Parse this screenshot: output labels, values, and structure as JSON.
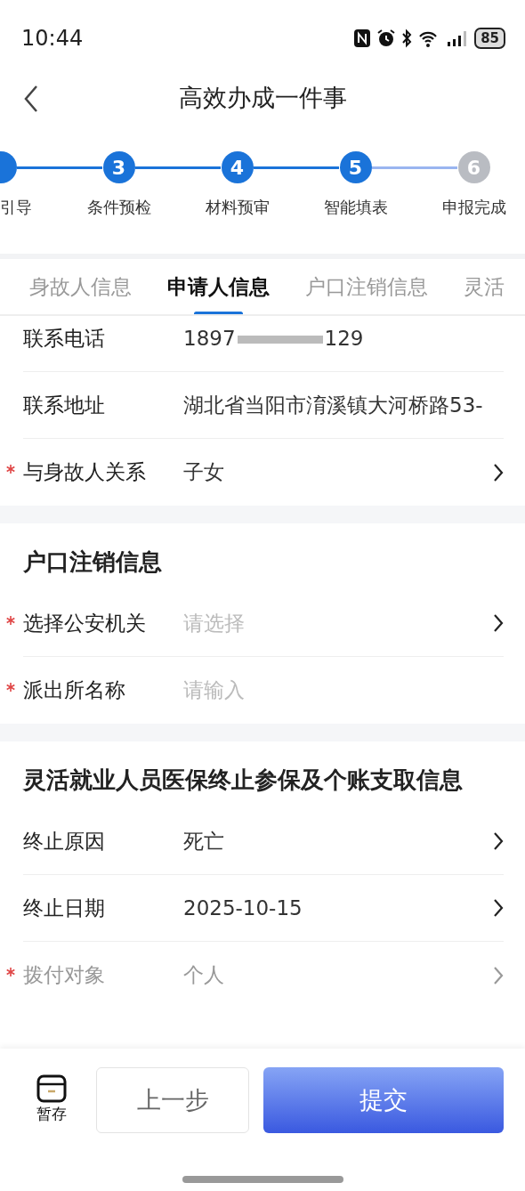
{
  "status_bar": {
    "time": "10:44",
    "battery": "85"
  },
  "header": {
    "title": "高效办成一件事"
  },
  "steps": [
    {
      "label": "引导",
      "done": true
    },
    {
      "number": "3",
      "label": "条件预检",
      "done": true
    },
    {
      "number": "4",
      "label": "材料预审",
      "done": true
    },
    {
      "number": "5",
      "label": "智能填表",
      "done": true
    },
    {
      "number": "6",
      "label": "申报完成",
      "done": false
    }
  ],
  "tabs": [
    {
      "label": "身故人信息",
      "selected": false
    },
    {
      "label": "申请人信息",
      "selected": true
    },
    {
      "label": "户口注销信息",
      "selected": false
    },
    {
      "label": "灵活",
      "selected": false
    }
  ],
  "sections": [
    {
      "rows": [
        {
          "label": "联系电话",
          "value_parts": [
            "1897",
            "129"
          ],
          "required": false,
          "arrow": false,
          "disabled": false
        },
        {
          "label": "联系地址",
          "value": "湖北省当阳市淯溪镇大河桥路53-",
          "required": false,
          "arrow": false,
          "disabled": false
        },
        {
          "label": "与身故人关系",
          "value": "子女",
          "required": true,
          "arrow": true,
          "disabled": false
        }
      ]
    },
    {
      "title": "户口注销信息",
      "rows": [
        {
          "label": "选择公安机关",
          "placeholder": "请选择",
          "required": true,
          "arrow": true,
          "disabled": false
        },
        {
          "label": "派出所名称",
          "placeholder": "请输入",
          "required": true,
          "arrow": false,
          "disabled": false
        }
      ]
    },
    {
      "title": "灵活就业人员医保终止参保及个账支取信息",
      "rows": [
        {
          "label": "终止原因",
          "value": "死亡",
          "required": false,
          "arrow": true,
          "disabled": false
        },
        {
          "label": "终止日期",
          "value": "2025-10-15",
          "required": false,
          "arrow": true,
          "disabled": false
        },
        {
          "label": "拨付对象",
          "value": "个人",
          "required": true,
          "arrow": true,
          "disabled": true
        }
      ]
    }
  ],
  "bottom_bar": {
    "save": "暂存",
    "previous": "上一步",
    "submit": "提交"
  }
}
